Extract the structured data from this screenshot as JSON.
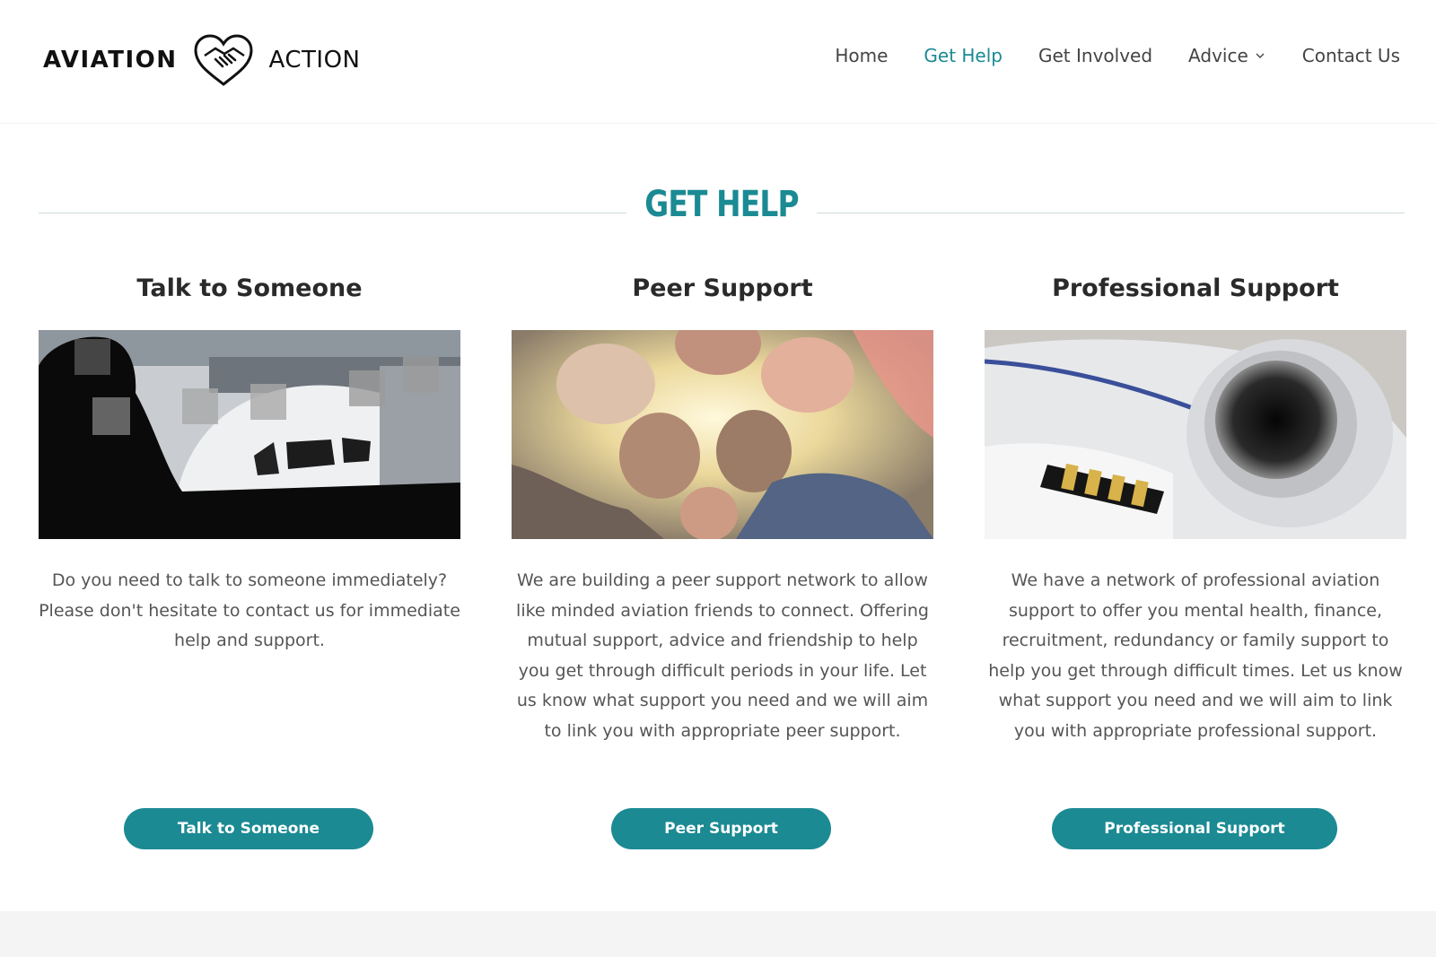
{
  "brand": {
    "name_bold": "AVIATION",
    "name_light": "ACTION",
    "accent_color": "#1b8a93",
    "icon": "heart-handshake-icon"
  },
  "nav": {
    "items": [
      {
        "label": "Home",
        "active": false
      },
      {
        "label": "Get Help",
        "active": true
      },
      {
        "label": "Get Involved",
        "active": false
      },
      {
        "label": "Advice",
        "active": false,
        "has_dropdown": true
      },
      {
        "label": "Contact Us",
        "active": false
      }
    ]
  },
  "section": {
    "title": "GET HELP"
  },
  "columns": [
    {
      "title": "Talk to Someone",
      "image": "person-on-phone-airport-photo",
      "text": "Do you need to talk to someone immediately? Please don't hesitate to contact us for immediate help and support.",
      "button": "Talk to Someone"
    },
    {
      "title": "Peer Support",
      "image": "friends-group-circle-photo",
      "text": "We are building a peer support network to allow like minded aviation friends to connect. Offering mutual support, advice and friendship to help you get through difficult periods in your life. Let us know what support you need and we will aim to link you with appropriate peer support.",
      "button": "Peer Support"
    },
    {
      "title": "Professional Support",
      "image": "pilot-epaulette-jet-engine-photo",
      "text": "We have a network of professional aviation support to offer you mental health, finance, recruitment, redundancy or family support to help you get through difficult times.   Let us know what support you need and we will aim to link you with appropriate professional support.",
      "button": "Professional Support"
    }
  ]
}
